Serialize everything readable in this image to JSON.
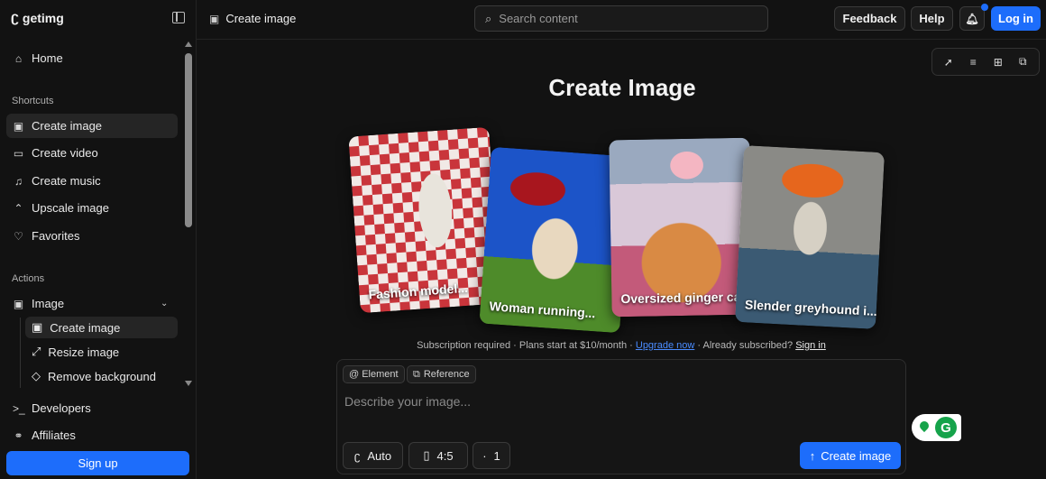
{
  "app": {
    "logo_text": "getimg",
    "logo_icon": "getimg-logo"
  },
  "sidebar": {
    "home": "Home",
    "shortcuts_label": "Shortcuts",
    "shortcuts": [
      "Create image",
      "Create video",
      "Create music",
      "Upscale image",
      "Favorites"
    ],
    "actions_label": "Actions",
    "image_group": "Image",
    "image_subitems": [
      "Create image",
      "Resize image",
      "Remove background"
    ],
    "developers": "Developers",
    "affiliates": "Affiliates",
    "signup": "Sign up"
  },
  "topbar": {
    "page_title": "Create image",
    "search_placeholder": "Search content",
    "feedback": "Feedback",
    "help": "Help",
    "login": "Log in"
  },
  "main": {
    "title": "Create Image",
    "cards": [
      {
        "caption": "Fashion model...",
        "accent": "#c9353b"
      },
      {
        "caption": "Woman running...",
        "accent": "#1c54c8"
      },
      {
        "caption": "Oversized ginger ca",
        "accent": "#d98a44"
      },
      {
        "caption": "Slender greyhound i...",
        "accent": "#e6661d"
      }
    ],
    "subscription": {
      "text": "Subscription required · Plans start at $10/month · ",
      "upgrade": "Upgrade now",
      "mid": " · Already subscribed? ",
      "signin": "Sign in"
    },
    "prompt": {
      "chip_element": "@ Element",
      "chip_reference": "Reference",
      "placeholder": "Describe your image...",
      "model": "Auto",
      "ratio": "4:5",
      "count": "1",
      "create": "Create image"
    }
  },
  "colors": {
    "accent": "#1d6dfb",
    "background": "#121212",
    "widget": "#15a34a"
  }
}
